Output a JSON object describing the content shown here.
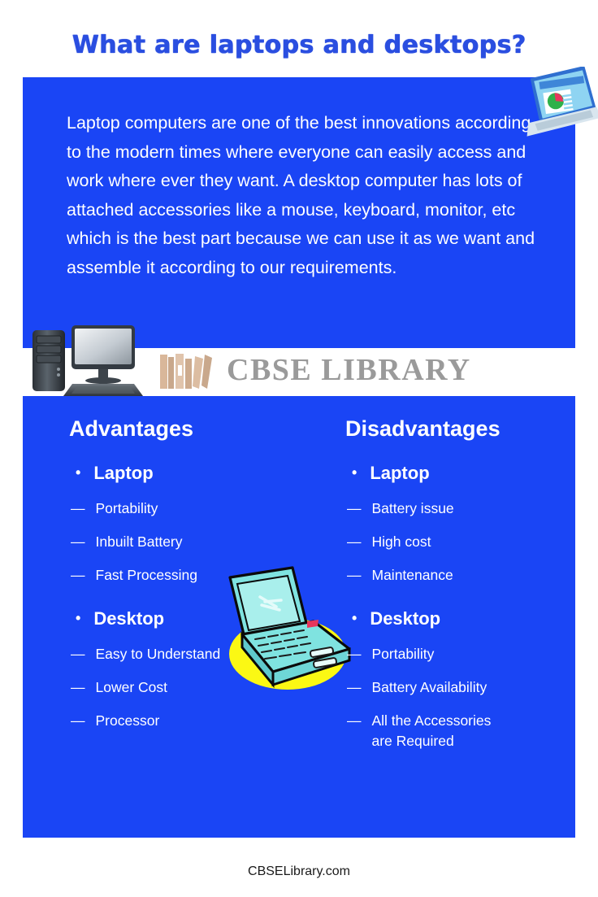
{
  "title": "What are laptops and desktops?",
  "intro": "Laptop computers are one of the best innovations according to the modern times where everyone can easily access and work where ever they want. A desktop computer has lots of attached accessories like a mouse, keyboard, monitor, etc which is the best part because we can use it as we want and assemble it according to our requirements.",
  "logo": {
    "text": "CBSE LIBRARY",
    "icon": "books-icon"
  },
  "columns": [
    {
      "heading": "Advantages",
      "groups": [
        {
          "title": "Laptop",
          "bullet": "•",
          "items": [
            "Portability",
            "Inbuilt Battery",
            "Fast Processing"
          ]
        },
        {
          "title": "Desktop",
          "bullet": "•",
          "items": [
            "Easy to Understand",
            "Lower Cost",
            "Processor"
          ]
        }
      ]
    },
    {
      "heading": "Disadvantages",
      "groups": [
        {
          "title": "Laptop",
          "bullet": "•",
          "items": [
            "Battery issue",
            "High cost",
            "Maintenance"
          ]
        },
        {
          "title": "Desktop",
          "bullet": "•",
          "items": [
            "Portability",
            "Battery Availability",
            "All the Accessories\nare Required"
          ]
        }
      ]
    }
  ],
  "dash": "—",
  "footer": "CBSELibrary.com",
  "colors": {
    "panel_blue": "#1a45f5",
    "title_blue": "#2a4ee0",
    "logo_gray": "#9a9a9a",
    "text_white": "#ffffff",
    "clipart_cyan": "#7fe3e0",
    "clipart_yellow": "#fbf814"
  },
  "artwork": [
    {
      "name": "laptop-chart-illustration",
      "position": "top-right"
    },
    {
      "name": "desktop-computer-illustration",
      "position": "mid-left"
    },
    {
      "name": "laptop-clipart-illustration",
      "position": "center"
    }
  ]
}
